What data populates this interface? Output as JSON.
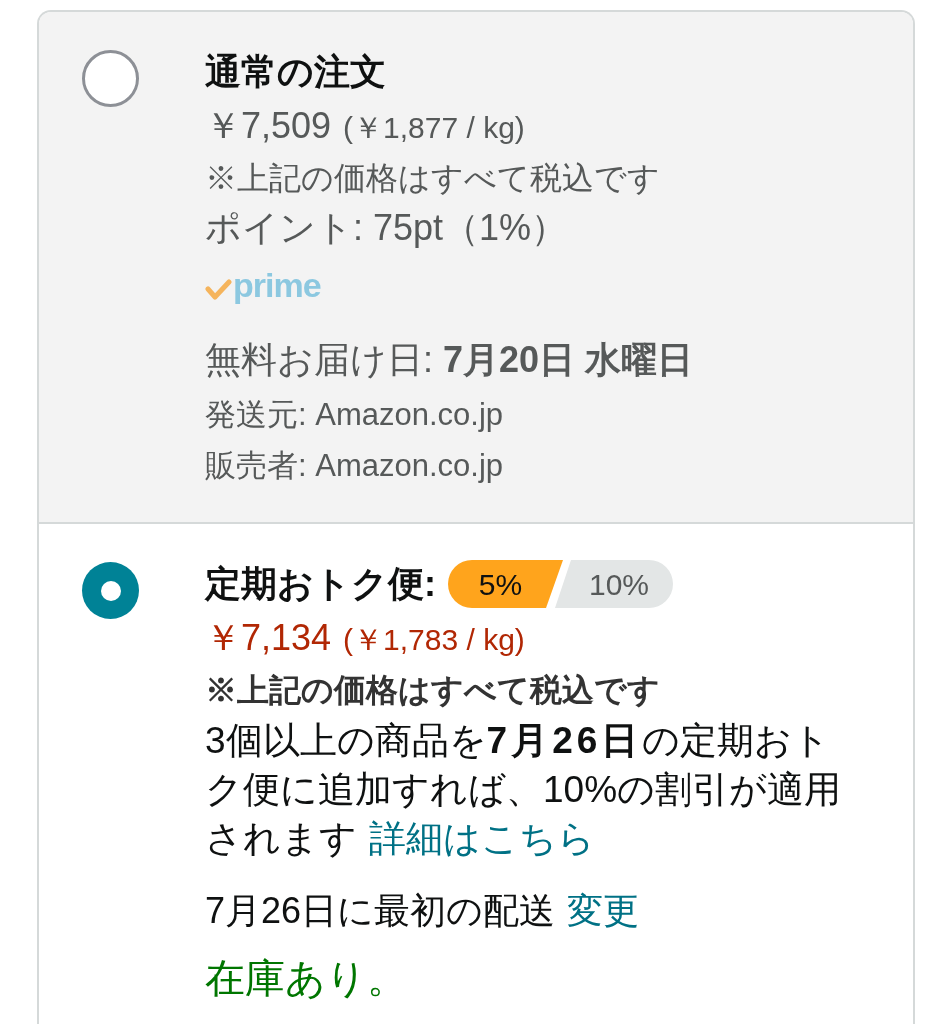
{
  "options": [
    {
      "kind": "standard",
      "selected": false,
      "title": "通常の注文",
      "price": "￥7,509",
      "unit_price": "(￥1,877 / kg)",
      "tax_note": "※上記の価格はすべて税込です",
      "points": "ポイント: 75pt（1%）",
      "prime_logo": "prime",
      "delivery": "無料お届け日: **7月20日 水曜日**",
      "ships_from": "発送元: Amazon.co.jp",
      "sold_by": "販売者: Amazon.co.jp"
    },
    {
      "kind": "subscribe",
      "selected": true,
      "title": "定期おトク便:",
      "discount_tiers": [
        {
          "label": "5%",
          "selected": true
        },
        {
          "label": "10%",
          "selected": false
        }
      ],
      "price": "￥7,134",
      "unit_price": "(￥1,783 / kg)",
      "tax_note": "※上記の価格はすべて税込です",
      "promo": "3個以上の商品を**7月26日**の定期おトク便に追加すれば、10%の割引が適用されます",
      "promo_link": "詳細はこちら",
      "first_delivery": "7月26日に最初の配送",
      "change_link": "変更",
      "availability": "在庫あり。"
    }
  ]
}
